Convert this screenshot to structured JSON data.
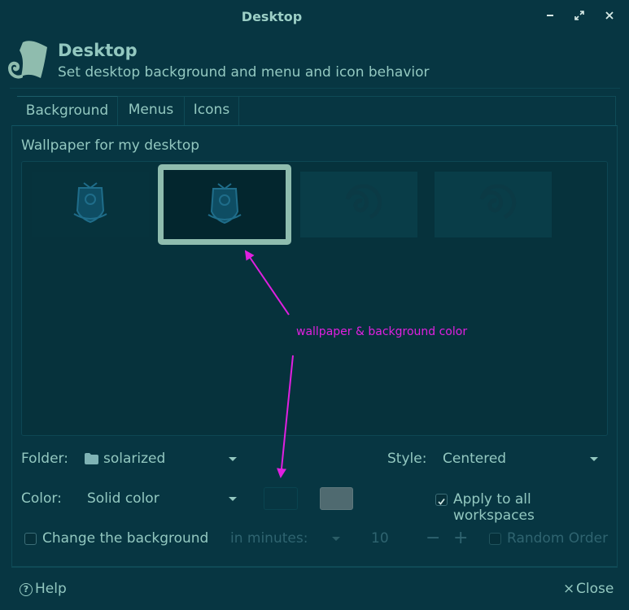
{
  "window": {
    "title": "Desktop",
    "minimize_icon": "minimize-icon",
    "maximize_icon": "maximize-icon",
    "close_icon": "close-icon"
  },
  "header": {
    "title": "Desktop",
    "subtitle": "Set desktop background and menu and icon behavior",
    "icon": "desktop-settings-icon"
  },
  "tabs": [
    {
      "label": "Background",
      "active": true
    },
    {
      "label": "Menus",
      "active": false
    },
    {
      "label": "Icons",
      "active": false
    }
  ],
  "wallpaper": {
    "section_label": "Wallpaper for my desktop",
    "thumbnails": [
      {
        "name": "emblem-wallpaper",
        "selected": false
      },
      {
        "name": "emblem-wallpaper",
        "selected": true
      },
      {
        "name": "swirl-wallpaper",
        "selected": false
      },
      {
        "name": "swirl-wallpaper",
        "selected": false
      }
    ]
  },
  "annotation": {
    "text": "wallpaper & background color",
    "color": "#e020e0"
  },
  "folder": {
    "label": "Folder:",
    "value": "solarized",
    "icon": "folder-icon"
  },
  "style": {
    "label": "Style:",
    "value": "Centered"
  },
  "color": {
    "label": "Color:",
    "value": "Solid color",
    "primary_swatch": "#073642",
    "secondary_swatch": "#4f6a70"
  },
  "apply_all": {
    "label": "Apply to all workspaces",
    "checked": true
  },
  "change_background": {
    "label": "Change the background",
    "checked": false,
    "interval_label": "in minutes:",
    "interval_value": "10",
    "minus": "−",
    "plus": "+",
    "random_label": "Random Order",
    "random_checked": false
  },
  "footer": {
    "help_label": "Help",
    "help_icon": "?",
    "close_label": "Close",
    "close_icon": "×"
  }
}
